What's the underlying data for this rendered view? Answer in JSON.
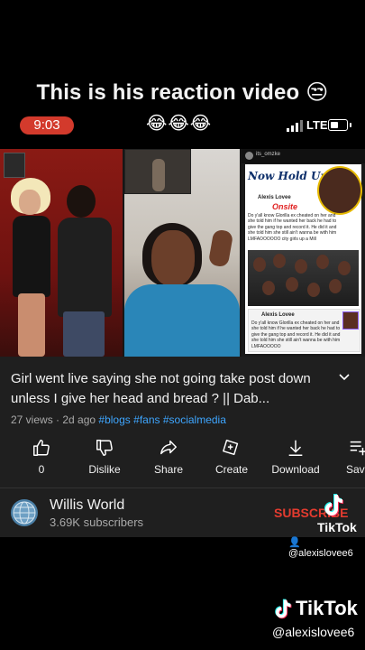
{
  "caption": "This is his reaction video 😒",
  "status": {
    "time": "9:03",
    "emojis": "😂😂😂",
    "network": "LTE"
  },
  "post": {
    "username": "its_omzke",
    "headline": "Now Hold Up!",
    "onsite": "Onsite",
    "author": "Alexis Lovee",
    "text": "Do y'all know Glorilla ex cheated on her and she told him if he wanted her back he had to give the gang top and record it. He did it and she told him she still ain't wanna be with him LMFAOOOOOO city girls up a Mill",
    "author2": "Alexis Lovee",
    "text2": "Do y'all know Glorilla ex cheated on her and she told him if he wanted her back he had to give the gang top and record it. He did it and she told him she still ain't wanna be with him LMFAOOOOO"
  },
  "video": {
    "title": "Girl went live saying she not going take post down unless I give her head and bread ? || Dab...",
    "views": "27 views",
    "age": "2d ago",
    "tags": [
      "#blogs",
      "#fans",
      "#socialmedia"
    ]
  },
  "actions": {
    "like": "0",
    "dislike": "Dislike",
    "share": "Share",
    "create": "Create",
    "download": "Download",
    "save": "Save"
  },
  "channel": {
    "name": "Willis World",
    "subscribers": "3.69K subscribers",
    "subscribe": "SUBSCRIBE"
  },
  "watermark": {
    "small_brand": "TikTok",
    "small_user": "@alexislovee6",
    "big_brand": "TikTok",
    "big_user": "@alexislovee6"
  },
  "colors": {
    "accent": "#d33a2c",
    "link": "#3ea6ff",
    "subscribe": "#e33b2f"
  }
}
